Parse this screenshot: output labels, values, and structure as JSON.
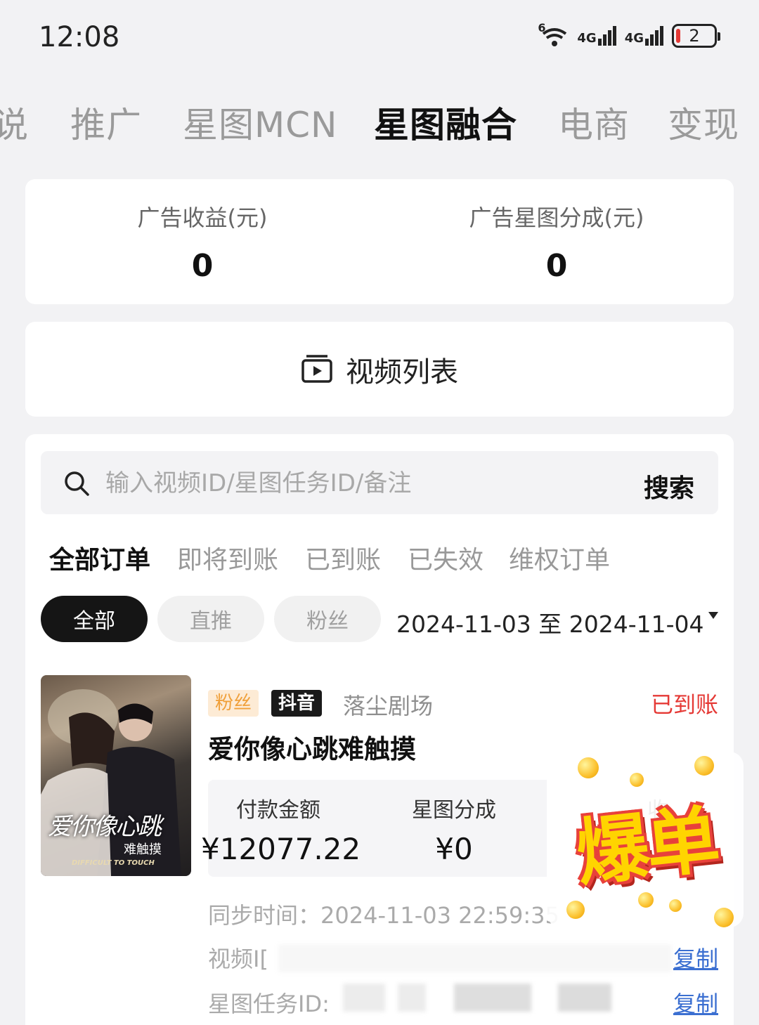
{
  "status_bar": {
    "time": "12:08",
    "wifi_label": "6",
    "net1": "4G",
    "net2": "4G",
    "battery": "2"
  },
  "top_tabs": [
    {
      "label": "说"
    },
    {
      "label": "推广"
    },
    {
      "label": "星图MCN"
    },
    {
      "label": "星图融合",
      "active": true
    },
    {
      "label": "电商"
    },
    {
      "label": "变现"
    }
  ],
  "stats": {
    "ad_revenue_label": "广告收益(元)",
    "ad_revenue_value": "0",
    "xingtu_share_label": "广告星图分成(元)",
    "xingtu_share_value": "0"
  },
  "video_list": {
    "label": "视频列表"
  },
  "search": {
    "placeholder": "输入视频ID/星图任务ID/备注",
    "button_label": "搜索"
  },
  "order_tabs": [
    {
      "label": "全部订单",
      "active": true
    },
    {
      "label": "即将到账"
    },
    {
      "label": "已到账"
    },
    {
      "label": "已失效"
    },
    {
      "label": "维权订单"
    }
  ],
  "filter_chips": [
    {
      "label": "全部",
      "active": true
    },
    {
      "label": "直推"
    },
    {
      "label": "粉丝"
    }
  ],
  "date_range": "2024-11-03 至 2024-11-04",
  "order": {
    "tag_type": "粉丝",
    "tag_platform": "抖音",
    "theater": "落尘剧场",
    "status": "已到账",
    "title": "爱你像心跳难触摸",
    "poster_text": "爱你像心跳",
    "poster_subtext": "难触摸",
    "poster_english": "DIFFICULT TO TOUCH",
    "payment_label": "付款金额",
    "payment_value": "¥12077.22",
    "share_label": "星图分成",
    "share_value": "¥0",
    "third_label_partial": "收",
    "sync_label": "同步时间：",
    "sync_value": "2024-11-03 22:59:35",
    "video_id_label": "视频I[",
    "task_id_label": "星图任务ID:",
    "copy_label": "复制"
  },
  "burst_badge": {
    "text": "爆单"
  },
  "colors": {
    "status_red": "#e53935",
    "copy_blue": "#3b6fd1",
    "fans_tag_bg": "#fdebd5",
    "fans_tag_fg": "#f0a03a",
    "badge_yellow": "#ffd400"
  }
}
